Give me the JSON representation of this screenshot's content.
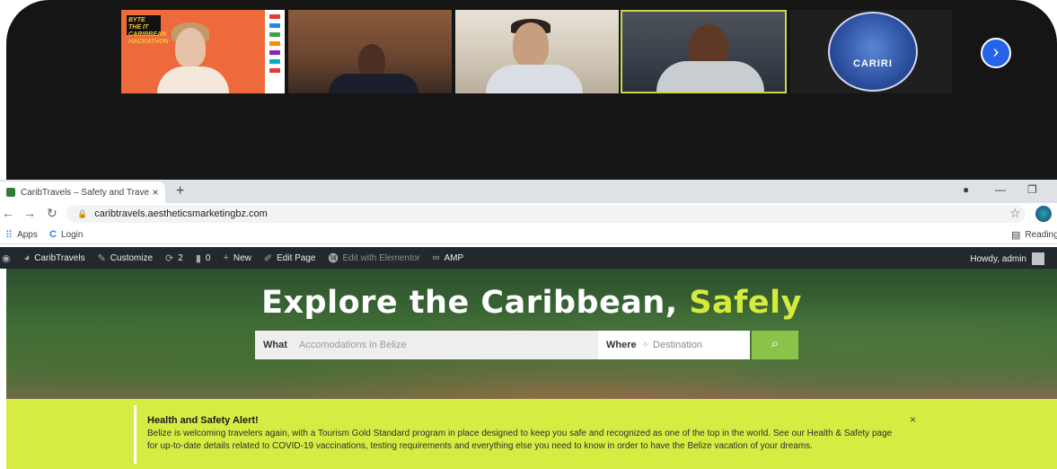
{
  "meeting": {
    "tile1_badge": "BYTE THE IT CARIBBEAN HACKATHON",
    "tile5_logo_text": "CARIRI",
    "next_icon": "chevron-right-icon"
  },
  "browser": {
    "tab_title": "CaribTravels – Safety and Travel C",
    "tab_close": "×",
    "new_tab": "+",
    "url": "caribtravels.aestheticsmarketingbz.com",
    "bookmarks": [
      {
        "label": "Apps"
      },
      {
        "label": "Login"
      }
    ],
    "reading_list": "Reading"
  },
  "adminbar": {
    "site": "CaribTravels",
    "customize": "Customize",
    "updates_count": "2",
    "comments_count": "0",
    "new": "New",
    "edit_page": "Edit Page",
    "edit_elementor": "Edit with Elementor",
    "amp": "AMP",
    "howdy": "Howdy, admin"
  },
  "hero": {
    "title_main": "Explore the Caribbean,",
    "title_accent": "Safely",
    "what_label": "What",
    "what_placeholder": "Accomodations in Belize",
    "where_label": "Where",
    "where_placeholder": "Destination"
  },
  "alert": {
    "title": "Health and Safety Alert!",
    "line1": "Belize is welcoming travelers again, with a Tourism Gold Standard program in place designed to keep you safe and recognized as one of the top in the world. See our Health & Safety page",
    "line2": "for up-to-date details related to COVID-19 vaccinations, testing requirements and everything else you need to know in order to have the Belize vacation of your dreams.",
    "close": "×"
  },
  "colors": {
    "accent_yellow": "#d4ea3c",
    "search_green": "#8bc34a",
    "alert_bg": "#d6ec43",
    "admin_bar": "#23282d"
  }
}
